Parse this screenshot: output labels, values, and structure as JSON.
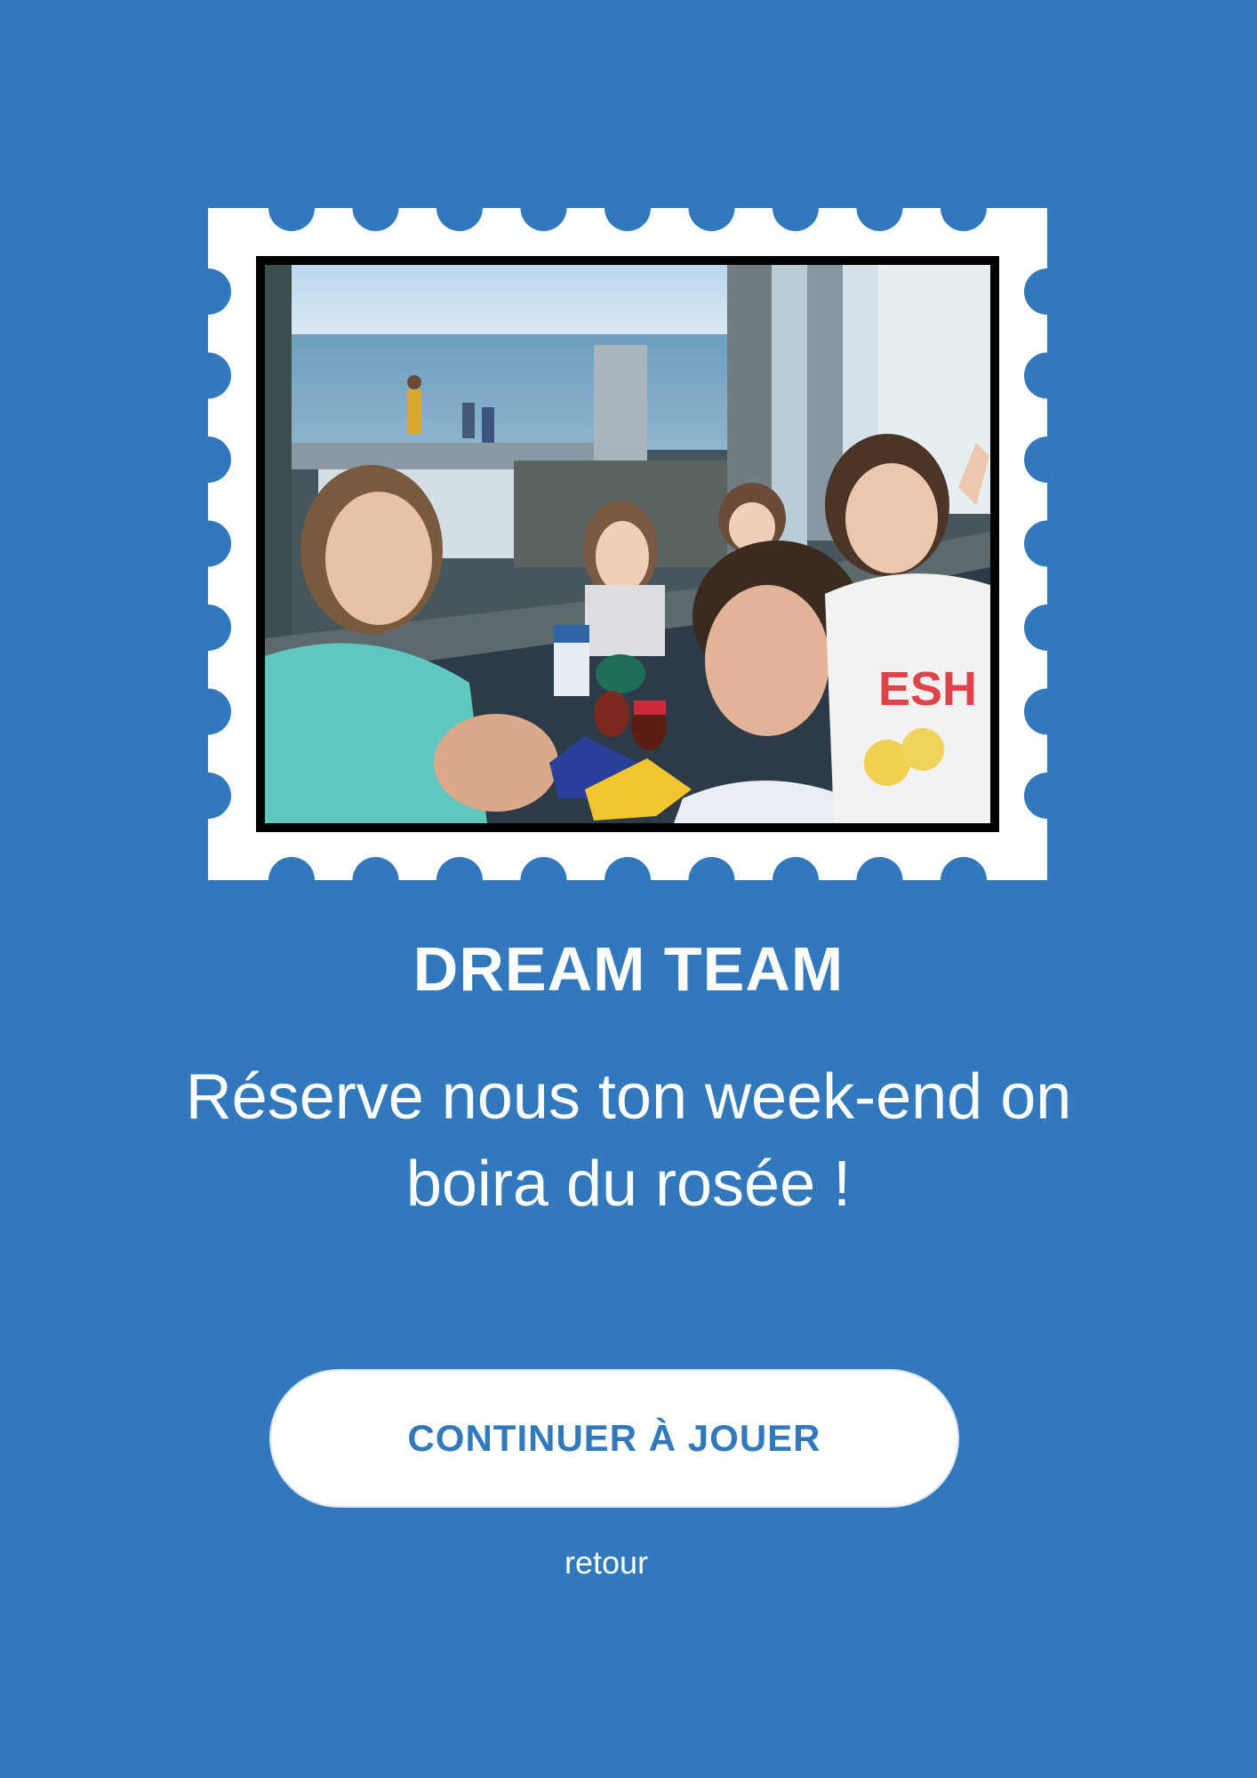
{
  "colors": {
    "background": "#3179bc",
    "stamp": "#ffffff",
    "button_text": "#3179bc"
  },
  "photo": {
    "alt": "Selfie de groupe d'enfants au bord de la mer"
  },
  "card": {
    "title": "DREAM TEAM",
    "message": "Réserve nous ton week-end on boira du rosée !"
  },
  "actions": {
    "continue_label": "CONTINUER À JOUER",
    "back_label": "retour"
  }
}
